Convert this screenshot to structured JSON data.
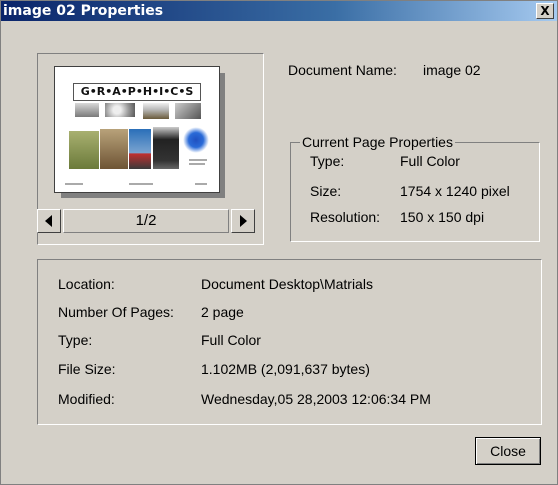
{
  "window": {
    "title": "image 02 Properties",
    "close_glyph": "X"
  },
  "preview": {
    "graphic_title": "G•R•A•P•H•I•C•S",
    "page_indicator": "1/2",
    "prev_icon": "triangle-left",
    "next_icon": "triangle-right"
  },
  "document": {
    "name_label": "Document Name:",
    "name_value": "image 02"
  },
  "current_page": {
    "group_title": "Current Page Properties",
    "type_label": "Type:",
    "type_value": "Full Color",
    "size_label": "Size:",
    "size_value": "1754 x 1240 pixel",
    "resolution_label": "Resolution:",
    "resolution_value": "150 x 150 dpi"
  },
  "details": {
    "location_label": "Location:",
    "location_value": "Document Desktop\\Matrials",
    "pages_label": "Number Of Pages:",
    "pages_value": "2 page",
    "type_label": "Type:",
    "type_value": "Full Color",
    "filesize_label": "File Size:",
    "filesize_value": "1.102MB (2,091,637 bytes)",
    "modified_label": "Modified:",
    "modified_value": "Wednesday,05 28,2003 12:06:34 PM"
  },
  "buttons": {
    "close_label": "Close"
  },
  "colors": {
    "titlebar_start": "#0a246a",
    "titlebar_end": "#a6caf0",
    "dialog_face": "#d4d0c8"
  }
}
